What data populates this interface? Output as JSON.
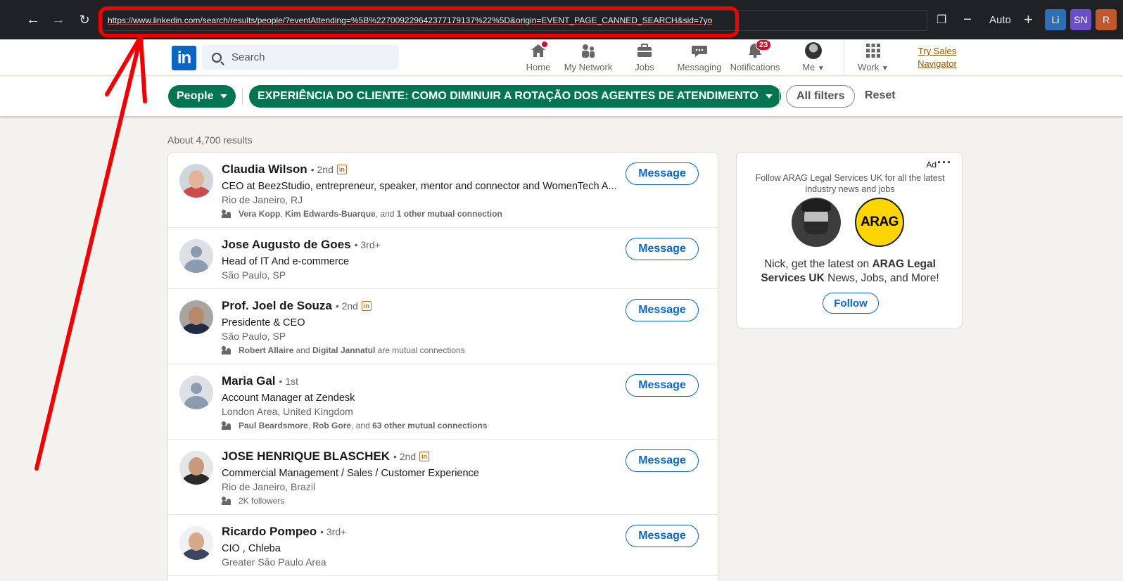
{
  "browser": {
    "url": "https://www.linkedin.com/search/results/people/?eventAttending=%5B%227009229642377179137%22%5D&origin=EVENT_PAGE_CANNED_SEARCH&sid=7yo",
    "zoom_label": "Auto",
    "profiles": [
      {
        "label": "Li",
        "color": "#2f6db5"
      },
      {
        "label": "SN",
        "color": "#6a4fc9"
      },
      {
        "label": "R",
        "color": "#c2572b"
      }
    ]
  },
  "header": {
    "logo_text": "in",
    "search_placeholder": "Search",
    "nav": [
      {
        "label": "Home",
        "icon": "home-icon"
      },
      {
        "label": "My Network",
        "icon": "network-icon"
      },
      {
        "label": "Jobs",
        "icon": "briefcase-icon"
      },
      {
        "label": "Messaging",
        "icon": "chat-icon"
      },
      {
        "label": "Notifications",
        "icon": "bell-icon",
        "badge": "23"
      },
      {
        "label": "Me",
        "icon": "avatar-icon"
      },
      {
        "label": "Work",
        "icon": "grid-icon"
      }
    ],
    "try_sales": "Try Sales Navigator"
  },
  "filters": {
    "people": "People",
    "event": "EXPERIÊNCIA DO CLIENTE: COMO DIMINUIR A ROTAÇÃO DOS AGENTES DE ATENDIMENTO",
    "all_filters": "All filters",
    "reset": "Reset"
  },
  "results_count": "About 4,700 results",
  "results": [
    {
      "name": "Claudia Wilson",
      "degree": "• 2nd",
      "premium": true,
      "headline": "CEO at BeezStudio, entrepreneur, speaker, mentor and connector and WomenTech A...",
      "location": "Rio de Janeiro, RJ",
      "mutual": [
        {
          "text": "Vera Kopp",
          "b": true
        },
        {
          "text": ", ",
          "b": false
        },
        {
          "text": "Kim Edwards-Buarque",
          "b": true
        },
        {
          "text": ", and ",
          "b": false
        },
        {
          "text": "1 other mutual connection",
          "b": true
        }
      ],
      "avatar": "photo",
      "face": "#e2b49a",
      "shoulders": "#c94b4b",
      "bg": "#cfd6dc",
      "button": "Message"
    },
    {
      "name": "Jose Augusto de Goes",
      "degree": "• 3rd+",
      "premium": false,
      "headline": "Head of IT And e-commerce",
      "location": "São Paulo, SP",
      "mutual": [],
      "avatar": "placeholder",
      "button": "Message"
    },
    {
      "name": "Prof. Joel de Souza",
      "degree": "• 2nd",
      "premium": true,
      "headline": "Presidente & CEO",
      "location": "São Paulo, SP",
      "mutual": [
        {
          "text": "Robert Allaire",
          "b": true
        },
        {
          "text": " and ",
          "b": false
        },
        {
          "text": "Digital Jannatul",
          "b": true
        },
        {
          "text": " are mutual connections",
          "b": false
        }
      ],
      "avatar": "photo",
      "face": "#b9896b",
      "shoulders": "#1f2b45",
      "bg": "#a9a49e",
      "button": "Message"
    },
    {
      "name": "Maria Gal",
      "degree": "• 1st",
      "premium": false,
      "headline": "Account Manager at Zendesk",
      "location": "London Area, United Kingdom",
      "mutual": [
        {
          "text": "Paul Beardsmore",
          "b": true
        },
        {
          "text": ", ",
          "b": false
        },
        {
          "text": "Rob Gore",
          "b": true
        },
        {
          "text": ", and ",
          "b": false
        },
        {
          "text": "63 other mutual connections",
          "b": true
        }
      ],
      "avatar": "placeholder",
      "button": "Message"
    },
    {
      "name": "JOSE HENRIQUE BLASCHEK",
      "degree": "• 2nd",
      "premium": true,
      "headline": "Commercial Management / Sales / Customer Experience",
      "location": "Rio de Janeiro, Brazil",
      "mutual": [
        {
          "text": "2K followers",
          "b": false
        }
      ],
      "avatar": "photo",
      "face": "#c89a7c",
      "shoulders": "#2a2a2a",
      "bg": "#e6e6e6",
      "button": "Message"
    },
    {
      "name": "Ricardo Pompeo",
      "degree": "• 3rd+",
      "premium": false,
      "headline": "CIO , Chleba",
      "location": "Greater São Paulo Area",
      "mutual": [],
      "avatar": "photo",
      "face": "#d7a88a",
      "shoulders": "#3a4660",
      "bg": "#eef0f2",
      "button": "Message"
    }
  ],
  "ad": {
    "label": "Ad",
    "follow_text": "Follow ARAG Legal Services UK for all the latest industry news and jobs",
    "logo_text": "ARAG",
    "headline_pre": "Nick, get the latest on ",
    "headline_bold": "ARAG Legal Services UK",
    "headline_post": " News, Jobs, and More!",
    "button": "Follow"
  }
}
